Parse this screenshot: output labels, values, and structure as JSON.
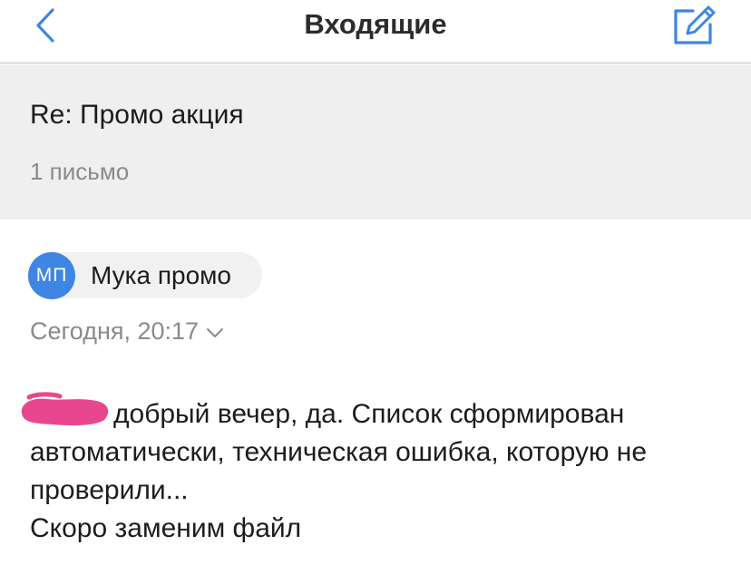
{
  "navbar": {
    "title": "Входящие",
    "back_icon": "chevron-left-icon",
    "compose_icon": "compose-icon",
    "accent_color": "#3e86e3"
  },
  "thread": {
    "subject": "Re: Промо акция",
    "count": "1 письмо"
  },
  "message": {
    "sender": {
      "initials": "МП",
      "name": "Мука промо",
      "avatar_color": "#3e86e3"
    },
    "date": "Сегодня, 20:17",
    "body_lines": [
      "добрый вечер, да. Список сформирован",
      "автоматически, техническая ошибка, которую не",
      "проверили...",
      "Скоро заменим файл"
    ]
  }
}
